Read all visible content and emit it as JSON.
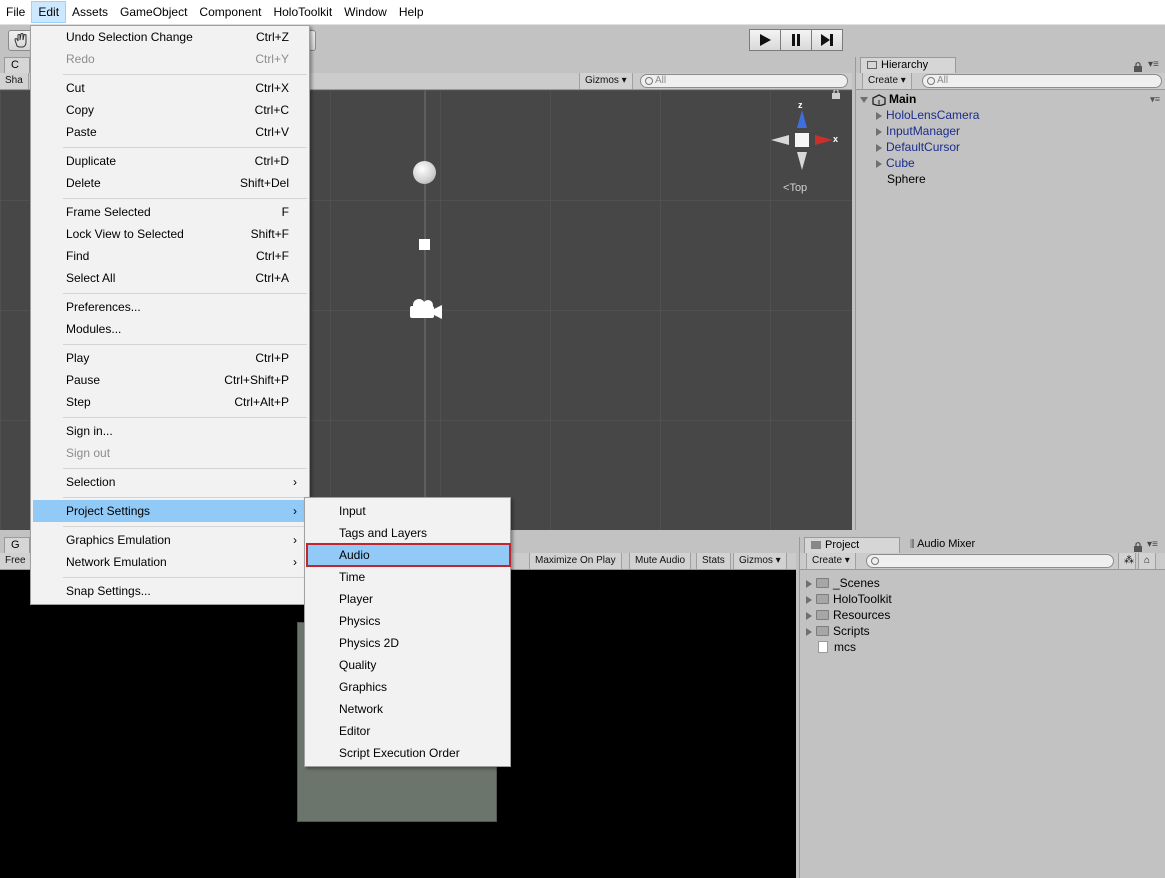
{
  "menubar": {
    "items": [
      "File",
      "Edit",
      "Assets",
      "GameObject",
      "Component",
      "HoloToolkit",
      "Window",
      "Help"
    ],
    "active_index": 1
  },
  "scene_panel": {
    "tab_label": "C",
    "toolbar_left": "Sha",
    "gizmos_label": "Gizmos",
    "search_placeholder": "All",
    "orientation_label": "Top",
    "axis_x": "x",
    "axis_z": "z"
  },
  "hierarchy": {
    "tab_label": "Hierarchy",
    "create_label": "Create",
    "search_placeholder": "All",
    "scene_name": "Main",
    "items": [
      {
        "label": "HoloLensCamera",
        "prefab": true
      },
      {
        "label": "InputManager",
        "prefab": true
      },
      {
        "label": "DefaultCursor",
        "prefab": true
      },
      {
        "label": "Cube",
        "prefab": true
      },
      {
        "label": "Sphere",
        "prefab": false
      }
    ]
  },
  "game_panel": {
    "tab_label": "G",
    "toolbar_left": "Free",
    "buttons": [
      "Maximize On Play",
      "Mute Audio",
      "Stats",
      "Gizmos"
    ]
  },
  "project": {
    "tab_label": "Project",
    "tab2_label": "Audio Mixer",
    "create_label": "Create",
    "items": [
      {
        "label": "_Scenes",
        "type": "folder"
      },
      {
        "label": "HoloToolkit",
        "type": "folder"
      },
      {
        "label": "Resources",
        "type": "folder"
      },
      {
        "label": "Scripts",
        "type": "folder"
      },
      {
        "label": "mcs",
        "type": "file"
      }
    ]
  },
  "edit_menu": {
    "items": [
      {
        "label": "Undo Selection Change",
        "shortcut": "Ctrl+Z"
      },
      {
        "label": "Redo",
        "shortcut": "Ctrl+Y",
        "disabled": true
      },
      {
        "label": "Cut",
        "shortcut": "Ctrl+X"
      },
      {
        "label": "Copy",
        "shortcut": "Ctrl+C"
      },
      {
        "label": "Paste",
        "shortcut": "Ctrl+V"
      },
      {
        "label": "Duplicate",
        "shortcut": "Ctrl+D"
      },
      {
        "label": "Delete",
        "shortcut": "Shift+Del"
      },
      {
        "label": "Frame Selected",
        "shortcut": "F"
      },
      {
        "label": "Lock View to Selected",
        "shortcut": "Shift+F"
      },
      {
        "label": "Find",
        "shortcut": "Ctrl+F"
      },
      {
        "label": "Select All",
        "shortcut": "Ctrl+A"
      },
      {
        "label": "Preferences...",
        "shortcut": ""
      },
      {
        "label": "Modules...",
        "shortcut": ""
      },
      {
        "label": "Play",
        "shortcut": "Ctrl+P"
      },
      {
        "label": "Pause",
        "shortcut": "Ctrl+Shift+P"
      },
      {
        "label": "Step",
        "shortcut": "Ctrl+Alt+P"
      },
      {
        "label": "Sign in...",
        "shortcut": ""
      },
      {
        "label": "Sign out",
        "shortcut": "",
        "disabled": true
      },
      {
        "label": "Selection",
        "shortcut": "",
        "submenu": true
      },
      {
        "label": "Project Settings",
        "shortcut": "",
        "submenu": true,
        "highlight": true
      },
      {
        "label": "Graphics Emulation",
        "shortcut": "",
        "submenu": true
      },
      {
        "label": "Network Emulation",
        "shortcut": "",
        "submenu": true
      },
      {
        "label": "Snap Settings...",
        "shortcut": ""
      }
    ]
  },
  "project_settings_menu": {
    "items": [
      "Input",
      "Tags and Layers",
      "Audio",
      "Time",
      "Player",
      "Physics",
      "Physics 2D",
      "Quality",
      "Graphics",
      "Network",
      "Editor",
      "Script Execution Order"
    ],
    "selected_index": 2
  }
}
